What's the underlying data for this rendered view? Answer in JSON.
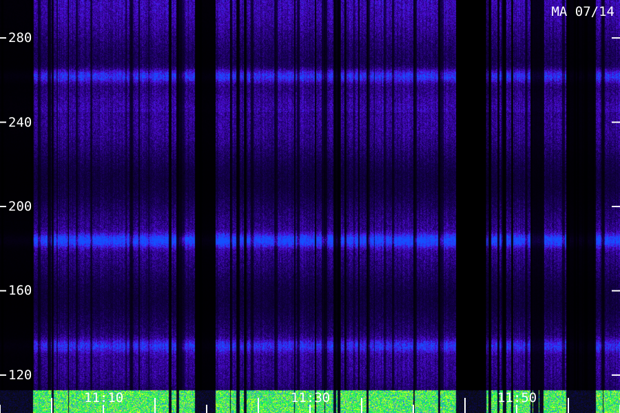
{
  "stamp": "MA 07/14",
  "chart_data": {
    "type": "heatmap",
    "title": "",
    "xlabel": "",
    "ylabel": "",
    "y_ticks": [
      120,
      160,
      200,
      240,
      280
    ],
    "y_tick_labels": [
      "120",
      "160",
      "200",
      "240",
      "280"
    ],
    "x_tick_labels": [
      "11:10",
      "11:30",
      "11:50"
    ],
    "ylim": [
      102,
      298
    ],
    "colormap": [
      "#000000",
      "#2a006e",
      "#4a10c8",
      "#2a3cff",
      "#18ff80",
      "#f0ff30"
    ],
    "bright_bands": [
      {
        "center": 184,
        "intensity": 0.95
      },
      {
        "center": 262,
        "intensity": 0.7
      },
      {
        "center": 134,
        "intensity": 0.55
      }
    ],
    "ground_band": {
      "from": 102,
      "to": 113,
      "color": "green-yellow"
    }
  }
}
